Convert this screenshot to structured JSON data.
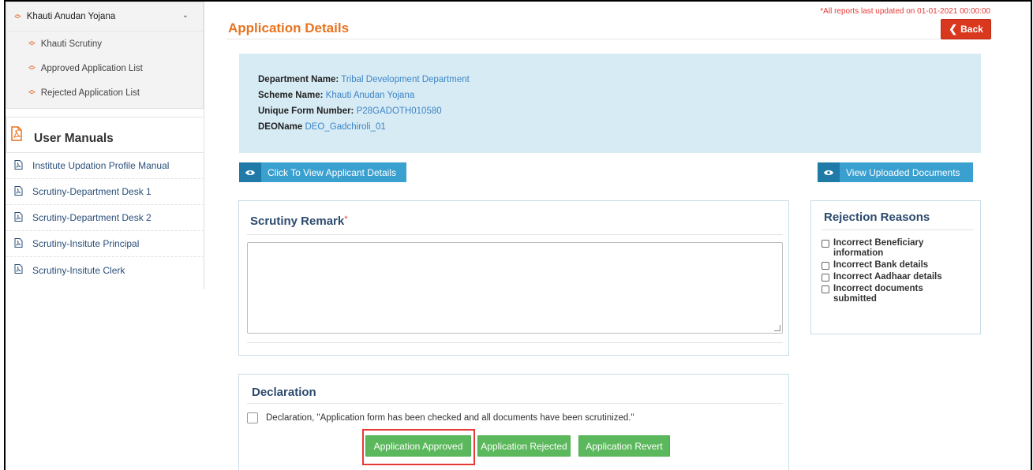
{
  "sidebar": {
    "parent": {
      "label": "Khauti Anudan Yojana",
      "icon": "diamond-icon",
      "chevron": "chevron-down-icon"
    },
    "children": [
      {
        "label": "Khauti Scrutiny"
      },
      {
        "label": "Approved Application List"
      },
      {
        "label": "Rejected Application List"
      }
    ],
    "manuals_heading": "User Manuals",
    "manuals": [
      {
        "label": "Institute Updation Profile Manual"
      },
      {
        "label": "Scrutiny-Department Desk 1"
      },
      {
        "label": "Scrutiny-Department Desk 2"
      },
      {
        "label": "Scrutiny-Insitute Principal"
      },
      {
        "label": "Scrutiny-Insitute Clerk"
      }
    ]
  },
  "header": {
    "notice": "*All reports last updated on 01-01-2021 00:00:00",
    "title": "Application Details",
    "back_label": "Back"
  },
  "info": {
    "dept_label": "Department Name:",
    "dept_value": "Tribal Development Department",
    "scheme_label": "Scheme Name:",
    "scheme_value": "Khauti Anudan Yojana",
    "form_label": "Unique Form Number:",
    "form_value": "P28GADOTH010580",
    "deo_label": "DEOName",
    "deo_value": "DEO_Gadchiroli_01"
  },
  "actions": {
    "view_applicant": "Click To View Applicant Details",
    "view_documents": "View Uploaded Documents"
  },
  "remark": {
    "title": "Scrutiny Remark",
    "required_mark": "*",
    "value": ""
  },
  "rejection": {
    "title": "Rejection Reasons",
    "reasons": [
      {
        "label": "Incorrect Beneficiary information",
        "checked": false
      },
      {
        "label": "Incorrect Bank details",
        "checked": false
      },
      {
        "label": "Incorrect Aadhaar details",
        "checked": false
      },
      {
        "label": "Incorrect documents submitted",
        "checked": false
      }
    ]
  },
  "declaration": {
    "title": "Declaration",
    "text": "Declaration, \"Application form has been checked and all documents have been scrutinized.\"",
    "checked": false,
    "approve_label": "Application Approved",
    "reject_label": "Application Rejected",
    "revert_label": "Application Revert"
  },
  "colors": {
    "accent_orange": "#e8731f",
    "button_green": "#5cb85c",
    "back_red": "#d9381e",
    "info_blue_bg": "#d7ebf5",
    "view_button": "#3aa0d0",
    "highlight": "#e53935"
  }
}
